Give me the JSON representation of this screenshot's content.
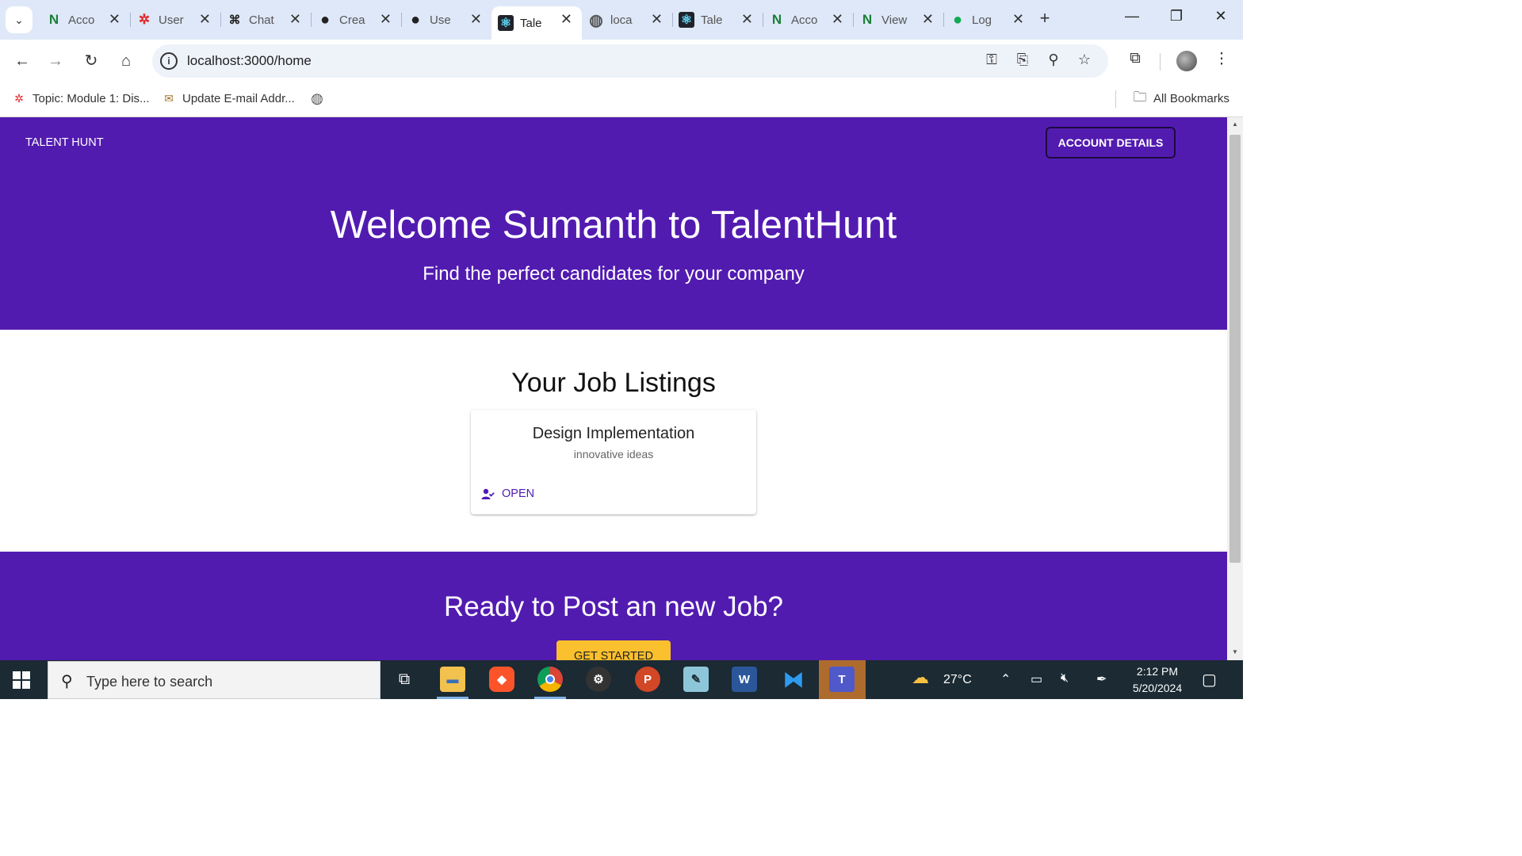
{
  "browser": {
    "tabs": [
      {
        "label": "Acco",
        "favicon": "N",
        "color": "#1a7f37"
      },
      {
        "label": "User",
        "favicon": "✲",
        "color": "#e0292b"
      },
      {
        "label": "Chat",
        "favicon": "⌘",
        "color": "#222222"
      },
      {
        "label": "Crea",
        "favicon": "●",
        "color": "#222222"
      },
      {
        "label": "Use",
        "favicon": "●",
        "color": "#222222"
      },
      {
        "label": "Tale",
        "favicon": "⚛",
        "color": "#61dafb",
        "active": true
      },
      {
        "label": "loca",
        "favicon": "◍",
        "color": "#555555"
      },
      {
        "label": "Tale",
        "favicon": "⚛",
        "color": "#61dafb"
      },
      {
        "label": "Acco",
        "favicon": "N",
        "color": "#1a7f37"
      },
      {
        "label": "View",
        "favicon": "N",
        "color": "#1a7f37"
      },
      {
        "label": "Log",
        "favicon": "●",
        "color": "#13aa52"
      }
    ],
    "tab_close_glyph": "✕",
    "new_tab_glyph": "+",
    "minimize_glyph": "—",
    "restore_glyph": "❐",
    "close_glyph": "✕",
    "address": "localhost:3000/home",
    "bookmarks": [
      {
        "label": "Topic: Module 1: Dis...",
        "icon": "✲"
      },
      {
        "label": "Update E-mail Addr...",
        "icon": "✉"
      }
    ],
    "all_bookmarks_label": "All Bookmarks"
  },
  "app": {
    "brand": "TALENT HUNT",
    "account_button": "ACCOUNT DETAILS",
    "welcome": "Welcome Sumanth to TalentHunt",
    "tagline": "Find the perfect candidates for your company",
    "listings_title": "Your Job Listings",
    "jobs": [
      {
        "title": "Design Implementation",
        "description": "innovative ideas",
        "action": "OPEN"
      }
    ],
    "cta_title": "Ready to Post an new Job?",
    "cta_button": "GET STARTED",
    "accent_color": "#521bb0",
    "cta_button_color": "#fbc02d"
  },
  "taskbar": {
    "search_placeholder": "Type here to search",
    "weather": "27°C",
    "time": "2:12 PM",
    "date": "5/20/2024"
  }
}
